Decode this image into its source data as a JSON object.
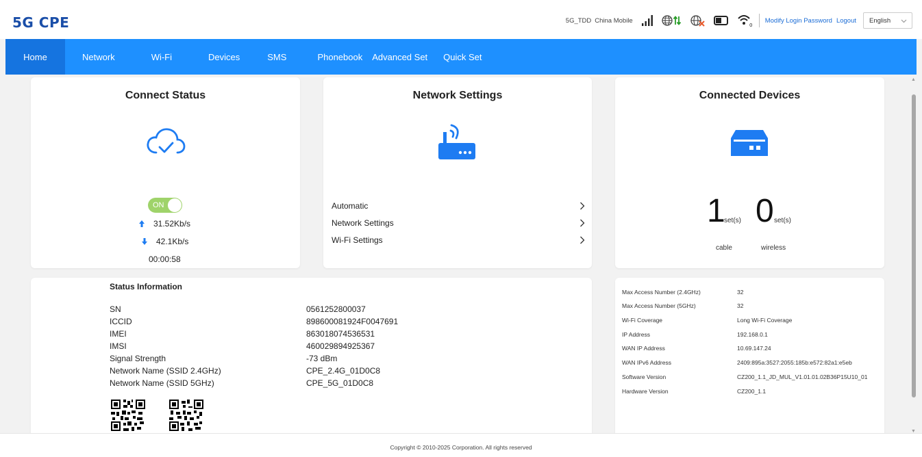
{
  "header": {
    "logo": "5G CPE",
    "network_type": "5G_TDD",
    "carrier": "China Mobile",
    "modify_password": "Modify Login Password",
    "logout": "Logout",
    "language": "English",
    "wifi_clients": "0"
  },
  "nav": {
    "items": [
      {
        "label": "Home",
        "active": true
      },
      {
        "label": "Network"
      },
      {
        "label": "Wi-Fi"
      },
      {
        "label": "Devices"
      },
      {
        "label": "SMS"
      },
      {
        "label": "Phonebook"
      },
      {
        "label": "Advanced Set"
      },
      {
        "label": "Quick Set"
      }
    ]
  },
  "connect_status": {
    "title": "Connect Status",
    "toggle": "ON",
    "upload": "31.52Kb/s",
    "download": "42.1Kb/s",
    "uptime": "00:00:58"
  },
  "network_settings": {
    "title": "Network Settings",
    "items": [
      "Automatic",
      "Network Settings",
      "Wi-Fi Settings"
    ]
  },
  "connected_devices": {
    "title": "Connected Devices",
    "cable_count": "1",
    "wireless_count": "0",
    "unit": "set(s)",
    "cable_label": "cable",
    "wireless_label": "wireless"
  },
  "status_info": {
    "title": "Status Information",
    "rows": [
      {
        "label": "SN",
        "value": "0561252800037"
      },
      {
        "label": "ICCID",
        "value": "898600081924F0047691"
      },
      {
        "label": "IMEI",
        "value": "863018074536531"
      },
      {
        "label": "IMSI",
        "value": "460029894925367"
      },
      {
        "label": "Signal Strength",
        "value": "-73 dBm"
      },
      {
        "label": "Network Name (SSID 2.4GHz)",
        "value": "CPE_2.4G_01D0C8"
      },
      {
        "label": "Network Name (SSID 5GHz)",
        "value": "CPE_5G_01D0C8"
      }
    ]
  },
  "device_info": {
    "rows": [
      {
        "label": "Max Access Number (2.4GHz)",
        "value": "32"
      },
      {
        "label": "Max Access Number (5GHz)",
        "value": "32"
      },
      {
        "label": "Wi-Fi Coverage",
        "value": "Long Wi-Fi Coverage"
      },
      {
        "label": "IP Address",
        "value": "192.168.0.1"
      },
      {
        "label": "WAN IP Address",
        "value": "10.69.147.24"
      },
      {
        "label": "WAN IPv6 Address",
        "value": "2409:895a:3527:2055:185b:e572:82a1:e5eb"
      },
      {
        "label": "Software Version",
        "value": "CZ200_1.1_JD_MUL_V1.01.01.02B36P15U10_01"
      },
      {
        "label": "Hardware Version",
        "value": "CZ200_1.1"
      }
    ]
  },
  "footer": {
    "copyright": "Copyright © 2010-2025 Corporation. All rights reserved"
  },
  "colors": {
    "brand": "#1a4ea8",
    "nav_bg": "#1e90ff",
    "nav_active": "#1574e0",
    "icon_blue": "#1e7cf2",
    "toggle_on": "#9fd36a",
    "link": "#1a6cd6"
  },
  "icons": {
    "signal": "signal-bars-icon",
    "internet": "globe-updown-icon",
    "roaming": "globe-disabled-icon",
    "battery": "battery-icon",
    "wifi": "wifi-icon",
    "cloud": "cloud-check-icon",
    "router": "router-icon",
    "device": "device-box-icon"
  }
}
